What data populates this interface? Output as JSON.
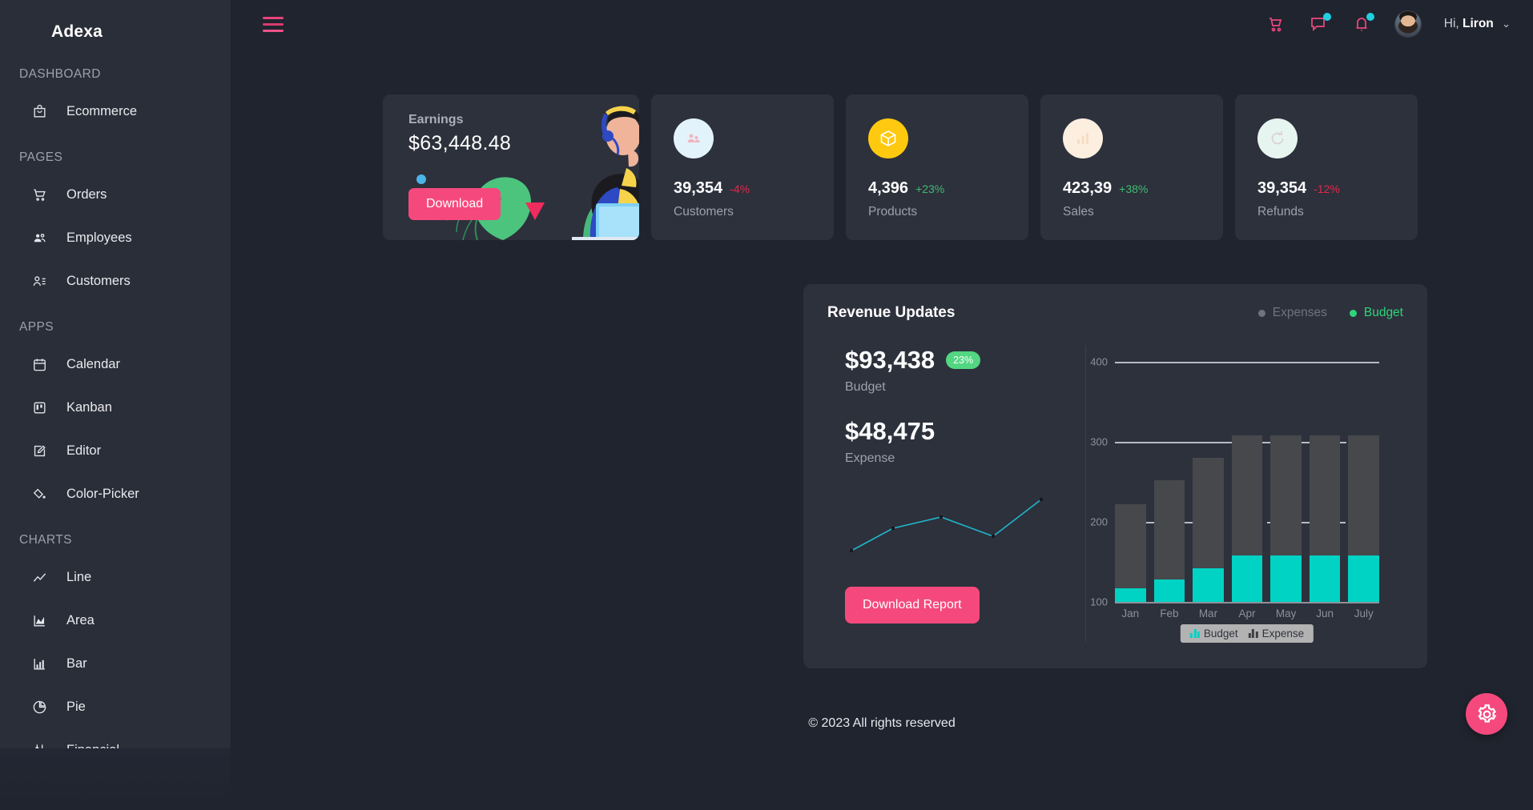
{
  "brand": {
    "name": "Adexa",
    "logo_icon": "moon-logo-icon"
  },
  "sidebar": {
    "sections": [
      {
        "title": "DASHBOARD",
        "items": [
          {
            "label": "Ecommerce",
            "icon": "shopping-bag-icon"
          }
        ]
      },
      {
        "title": "PAGES",
        "items": [
          {
            "label": "Orders",
            "icon": "shopping-cart-icon"
          },
          {
            "label": "Employees",
            "icon": "users-icon"
          },
          {
            "label": "Customers",
            "icon": "user-list-icon"
          }
        ]
      },
      {
        "title": "APPS",
        "items": [
          {
            "label": "Calendar",
            "icon": "calendar-icon"
          },
          {
            "label": "Kanban",
            "icon": "kanban-board-icon"
          },
          {
            "label": "Editor",
            "icon": "edit-pencil-icon"
          },
          {
            "label": "Color-Picker",
            "icon": "color-picker-icon"
          }
        ]
      },
      {
        "title": "CHARTS",
        "items": [
          {
            "label": "Line",
            "icon": "line-chart-icon"
          },
          {
            "label": "Area",
            "icon": "area-chart-icon"
          },
          {
            "label": "Bar",
            "icon": "bar-chart-icon"
          },
          {
            "label": "Pie",
            "icon": "pie-chart-icon"
          },
          {
            "label": "Financial",
            "icon": "financial-chart-icon"
          }
        ]
      }
    ]
  },
  "header": {
    "menu_icon": "hamburger-menu-icon",
    "cart_icon": "shopping-cart-icon",
    "chat_icon": "chat-bubble-icon",
    "notification_icon": "bell-icon",
    "greeting": "Hi,",
    "user_name": "Liron",
    "caret": "⌄"
  },
  "earnings": {
    "title": "Earnings",
    "value": "$63,448.48",
    "button_label": "Download"
  },
  "stats": [
    {
      "label": "Customers",
      "value": "39,354",
      "delta": "-4%",
      "delta_color": "#e0294a",
      "circle_color": "#e3f3fb",
      "icon": "customers-people-icon",
      "icon_color": "#f0b7be"
    },
    {
      "label": "Products",
      "value": "4,396",
      "delta": "+23%",
      "delta_color": "#3fbb72",
      "circle_color": "#fec90f",
      "icon": "product-box-icon",
      "icon_color": "#ffffff"
    },
    {
      "label": "Sales",
      "value": "423,39",
      "delta": "+38%",
      "delta_color": "#3fbb72",
      "circle_color": "#fdefe0",
      "icon": "sales-bars-icon",
      "icon_color": "#f6dcc3"
    },
    {
      "label": "Refunds",
      "value": "39,354",
      "delta": "-12%",
      "delta_color": "#e0294a",
      "circle_color": "#e6f5ef",
      "icon": "refund-refresh-icon",
      "icon_color": "#dcd0d7"
    }
  ],
  "revenue": {
    "title": "Revenue Updates",
    "legend": [
      {
        "label": "Expenses",
        "color": "#6e747f",
        "active": false
      },
      {
        "label": "Budget",
        "color": "#2ed47a",
        "active": true
      }
    ],
    "budget": {
      "value": "$93,438",
      "label": "Budget",
      "badge": "23%"
    },
    "expense": {
      "value": "$48,475",
      "label": "Expense"
    },
    "download_report_label": "Download Report"
  },
  "chart_data": {
    "type": "bar",
    "title": "Revenue Updates",
    "categories": [
      "Jan",
      "Feb",
      "Mar",
      "Apr",
      "May",
      "Jun",
      "July"
    ],
    "series": [
      {
        "name": "Budget",
        "color": "#00d2c4",
        "values": [
          105,
          115,
          128,
          142,
          142,
          142,
          142
        ]
      },
      {
        "name": "Expense",
        "color": "#46484b",
        "values": [
          222,
          252,
          280,
          308,
          308,
          308,
          308
        ]
      }
    ],
    "ylim": [
      100,
      400
    ],
    "yticks": [
      100,
      200,
      300,
      400
    ],
    "xlabel": "",
    "ylabel": "",
    "grid": true,
    "legend_position": "bottom",
    "legend_entries": [
      "Budget",
      "Expense"
    ]
  },
  "sparkline": {
    "type": "line",
    "color": "#1fb6c9",
    "points": [
      [
        0,
        10
      ],
      [
        25,
        45
      ],
      [
        50,
        62
      ],
      [
        75,
        30
      ],
      [
        100,
        78
      ]
    ]
  },
  "footer": {
    "text": "© 2023 All rights reserved"
  },
  "fab": {
    "icon": "settings-gear-icon"
  }
}
